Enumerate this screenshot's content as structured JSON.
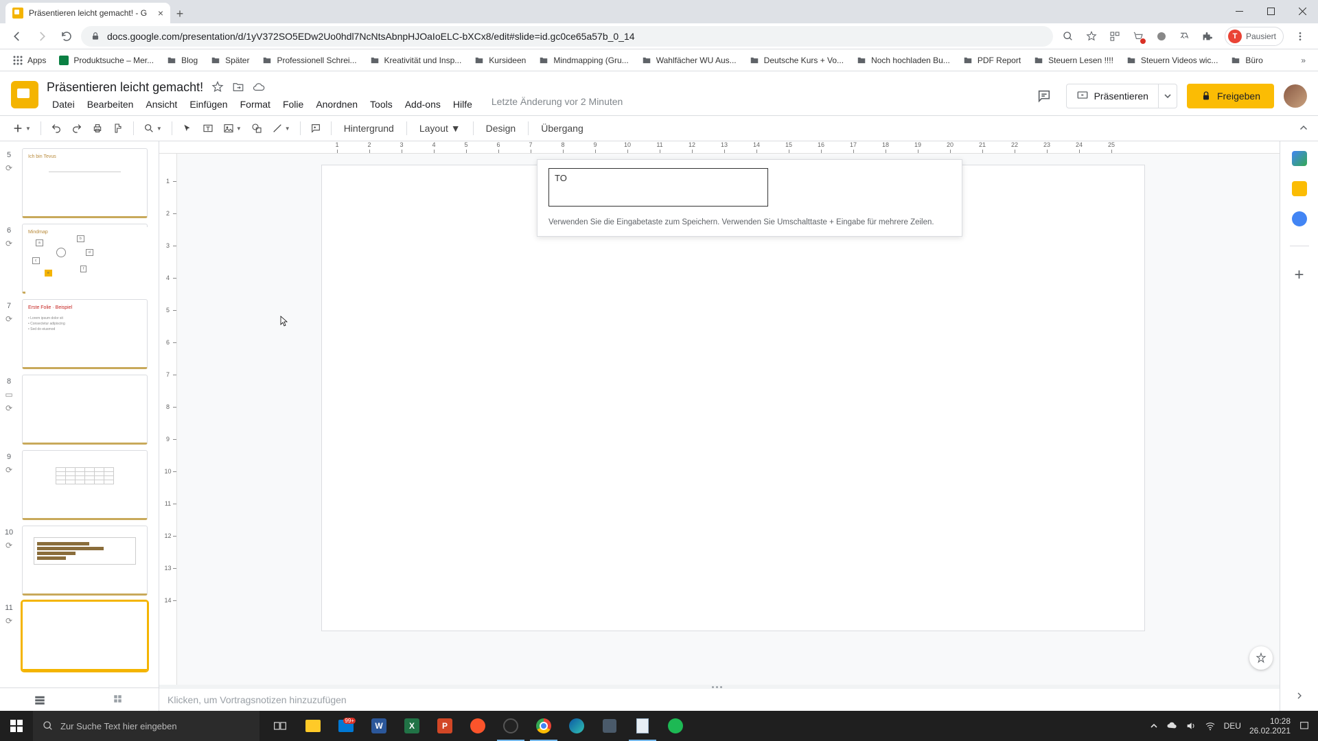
{
  "browser": {
    "tab_title": "Präsentieren leicht gemacht! - G",
    "url": "docs.google.com/presentation/d/1yV372SO5EDw2Uo0hdl7NcNtsAbnpHJOaIoELC-bXCx8/edit#slide=id.gc0ce65a57b_0_14",
    "profile_label": "Pausiert",
    "profile_initial": "T"
  },
  "bookmarks": {
    "apps": "Apps",
    "items": [
      "Produktsuche – Mer...",
      "Blog",
      "Später",
      "Professionell Schrei...",
      "Kreativität und Insp...",
      "Kursideen",
      "Mindmapping  (Gru...",
      "Wahlfächer WU Aus...",
      "Deutsche Kurs + Vo...",
      "Noch hochladen Bu...",
      "PDF Report",
      "Steuern Lesen !!!!",
      "Steuern Videos wic...",
      "Büro"
    ]
  },
  "app": {
    "doc_title": "Präsentieren leicht gemacht!",
    "last_edit": "Letzte Änderung vor 2 Minuten",
    "menus": [
      "Datei",
      "Bearbeiten",
      "Ansicht",
      "Einfügen",
      "Format",
      "Folie",
      "Anordnen",
      "Tools",
      "Add-ons",
      "Hilfe"
    ],
    "present_label": "Präsentieren",
    "share_label": "Freigeben"
  },
  "toolbar": {
    "hintergrund": "Hintergrund",
    "layout": "Layout",
    "design": "Design",
    "uebergang": "Übergang"
  },
  "ruler": {
    "h": [
      "1",
      "2",
      "3",
      "4",
      "5",
      "6",
      "7",
      "8",
      "9",
      "10",
      "11",
      "12",
      "13",
      "14",
      "15",
      "16",
      "17",
      "18",
      "19",
      "20",
      "21",
      "22",
      "23",
      "24",
      "25"
    ],
    "v": [
      "1",
      "2",
      "3",
      "4",
      "5",
      "6",
      "7",
      "8",
      "9",
      "10",
      "11",
      "12",
      "13",
      "14"
    ]
  },
  "filmstrip": {
    "slides": [
      {
        "num": "5",
        "title": "Ich bin Tevus"
      },
      {
        "num": "6",
        "title": "Mindmap"
      },
      {
        "num": "7",
        "title": "Erste Folie · Beispiel"
      },
      {
        "num": "8",
        "title": ""
      },
      {
        "num": "9",
        "title": ""
      },
      {
        "num": "10",
        "title": ""
      },
      {
        "num": "11",
        "title": ""
      }
    ],
    "selected_index": 6
  },
  "note_popup": {
    "input_value": "TO",
    "hint": "Verwenden Sie die Eingabetaste zum Speichern. Verwenden Sie Umschalttaste + Eingabe für mehrere Zeilen."
  },
  "speaker_notes": {
    "placeholder": "Klicken, um Vortragsnotizen hinzuzufügen"
  },
  "taskbar": {
    "search_placeholder": "Zur Suche Text hier eingeben",
    "notif_count": "99+",
    "lang": "DEU",
    "time": "10:28",
    "date": "26.02.2021"
  }
}
